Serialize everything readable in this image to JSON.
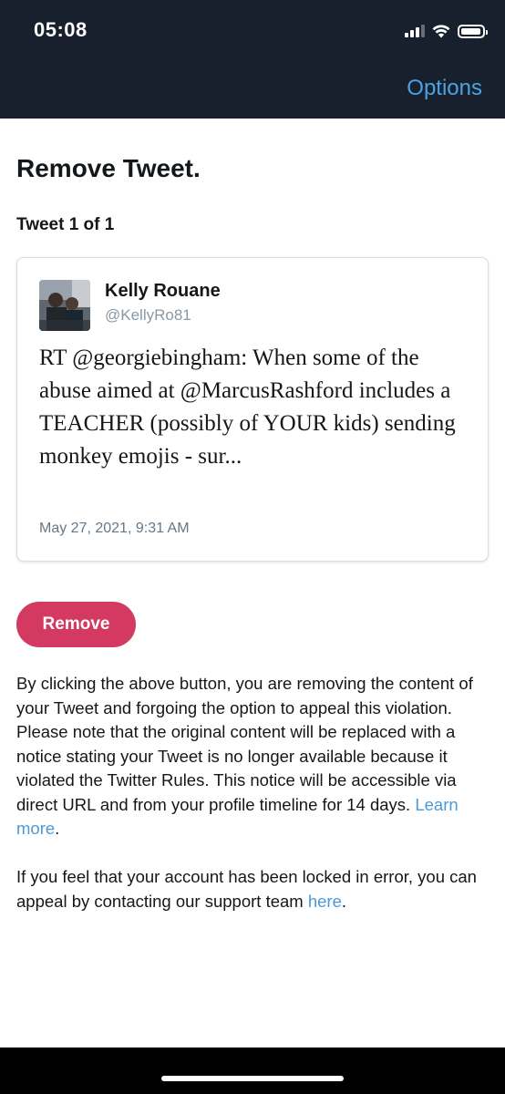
{
  "status_bar": {
    "time": "05:08",
    "signal_bars": 4,
    "signal_active": 3,
    "battery_level": 0.9
  },
  "nav": {
    "options_label": "Options"
  },
  "page": {
    "title": "Remove Tweet.",
    "tweet_counter": "Tweet 1 of 1"
  },
  "tweet": {
    "author_name": "Kelly Rouane",
    "author_handle": "@KellyRo81",
    "text": "RT @georgiebingham: When some of the abuse aimed at @MarcusRashford includes a TEACHER (possibly of YOUR kids) sending monkey emojis - sur...",
    "date": "May 27, 2021, 9:31 AM",
    "avatar_icon": "profile-photo"
  },
  "actions": {
    "remove_label": "Remove"
  },
  "disclaimer": {
    "text": "By clicking the above button, you are removing the content of your Tweet and forgoing the option to appeal this violation. Please note that the original content will be replaced with a notice stating your Tweet is no longer available because it violated the Twitter Rules. This notice will be accessible via direct URL and from your profile timeline for 14 days.",
    "link_label": "Learn more",
    "trailing": "."
  },
  "appeal": {
    "text": "If you feel that your account has been locked in error, you can appeal by contacting our support team",
    "link_label": "here",
    "trailing": "."
  },
  "colors": {
    "header_bg": "#17202c",
    "link": "#4a9ad9",
    "remove_button": "#d43a61"
  }
}
